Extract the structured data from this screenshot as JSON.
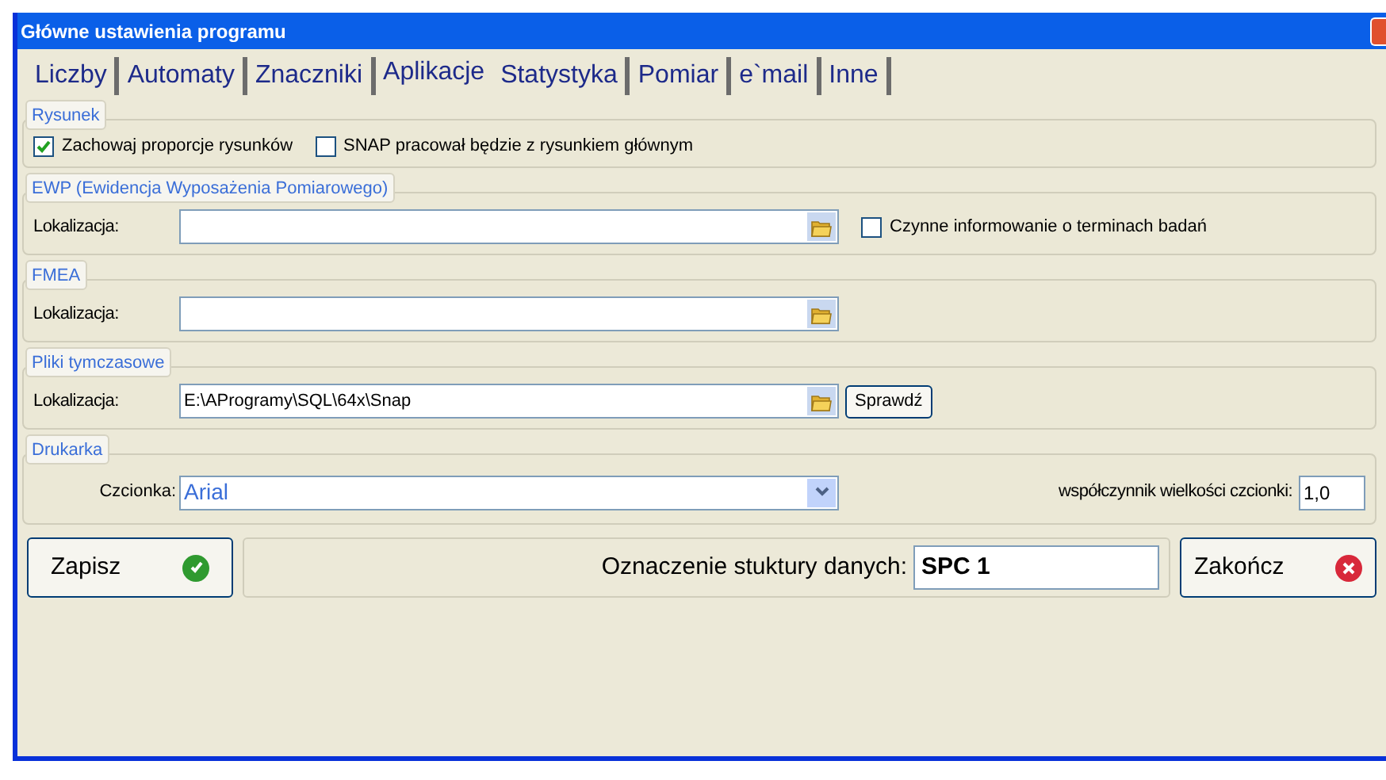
{
  "window": {
    "title": "Główne ustawienia programu"
  },
  "tabs": [
    {
      "label": "Liczby",
      "selected": false
    },
    {
      "label": "Automaty",
      "selected": false
    },
    {
      "label": "Znaczniki",
      "selected": false
    },
    {
      "label": "Aplikacje",
      "selected": true
    },
    {
      "label": "Statystyka",
      "selected": false
    },
    {
      "label": "Pomiar",
      "selected": false
    },
    {
      "label": "e`mail",
      "selected": false
    },
    {
      "label": "Inne",
      "selected": false
    }
  ],
  "sections": [
    {
      "kind": "checkboxes",
      "legend": "Rysunek",
      "checkboxes": [
        {
          "label": "Zachowaj proporcje rysunków",
          "checked": true
        },
        {
          "label": "SNAP pracował będzie z rysunkiem głównym",
          "checked": false
        }
      ]
    },
    {
      "kind": "path",
      "legend": "EWP (Ewidencja Wyposażenia Pomiarowego)",
      "label": "Lokalizacja:",
      "checkbox": {
        "label": "Czynne informowanie o terminach badań",
        "checked": false
      }
    },
    {
      "kind": "path",
      "legend": "FMEA",
      "label": "Lokalizacja:"
    },
    {
      "kind": "path",
      "legend": "Pliki tymczasowe",
      "label": "Lokalizacja:",
      "value": "E:\\AProgramy\\SQL\\64x\\Snap",
      "button": "Sprawdź"
    },
    {
      "kind": "font",
      "legend": "Drukarka",
      "label": "Czcionka:",
      "value": "Arial",
      "factor_label": "współczynnik wielkości czcionki:",
      "factor_value": "1,0"
    }
  ],
  "footer": {
    "save_button": "Zapisz",
    "structure_label": "Oznaczenie stuktury danych:",
    "structure_value": "SPC 1",
    "close_button": "Zakończ"
  }
}
